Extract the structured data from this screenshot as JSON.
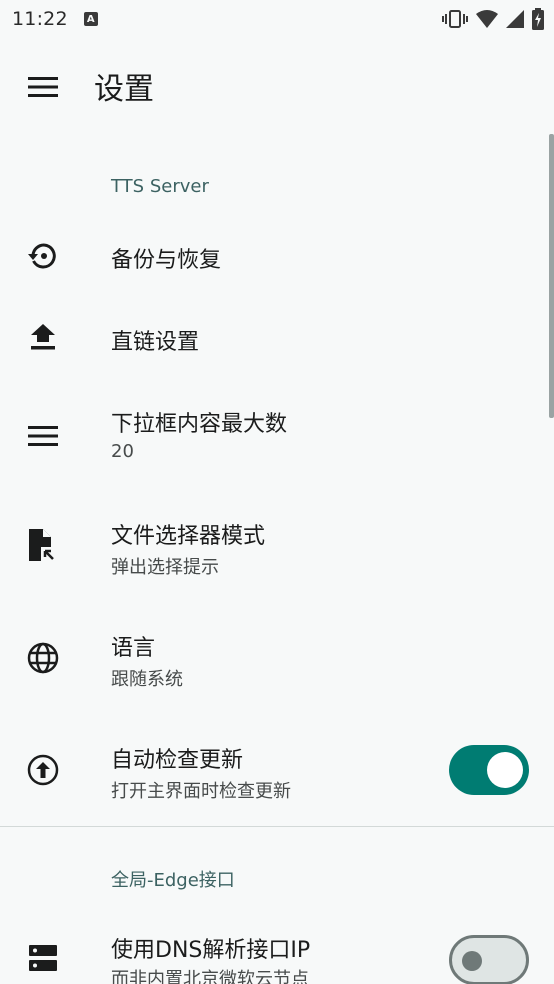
{
  "status_bar": {
    "time": "11:22",
    "notification_icon_label": "A",
    "icons": [
      "vibrate-icon",
      "wifi-icon",
      "signal-icon",
      "battery-charging-icon"
    ]
  },
  "app_bar": {
    "title": "设置",
    "menu_icon": "hamburger-menu-icon"
  },
  "sections": [
    {
      "header": "TTS Server",
      "items": [
        {
          "icon": "backup-restore-icon",
          "title": "备份与恢复"
        },
        {
          "icon": "upload-icon",
          "title": "直链设置"
        },
        {
          "icon": "menu-lines-icon",
          "title": "下拉框内容最大数",
          "subtitle": "20"
        },
        {
          "icon": "file-select-icon",
          "title": "文件选择器模式",
          "subtitle": "弹出选择提示"
        },
        {
          "icon": "globe-icon",
          "title": "语言",
          "subtitle": "跟随系统"
        },
        {
          "icon": "upgrade-circle-icon",
          "title": "自动检查更新",
          "subtitle": "打开主界面时检查更新",
          "switch_on": true
        }
      ]
    },
    {
      "header": "全局-Edge接口",
      "items": [
        {
          "icon": "dns-server-icon",
          "title": "使用DNS解析接口IP",
          "subtitle": "而非内置北京微软云节点",
          "switch_on": false
        }
      ]
    }
  ],
  "colors": {
    "background": "#f7f9f9",
    "accent": "#007c72",
    "category_text": "#3c6262"
  }
}
